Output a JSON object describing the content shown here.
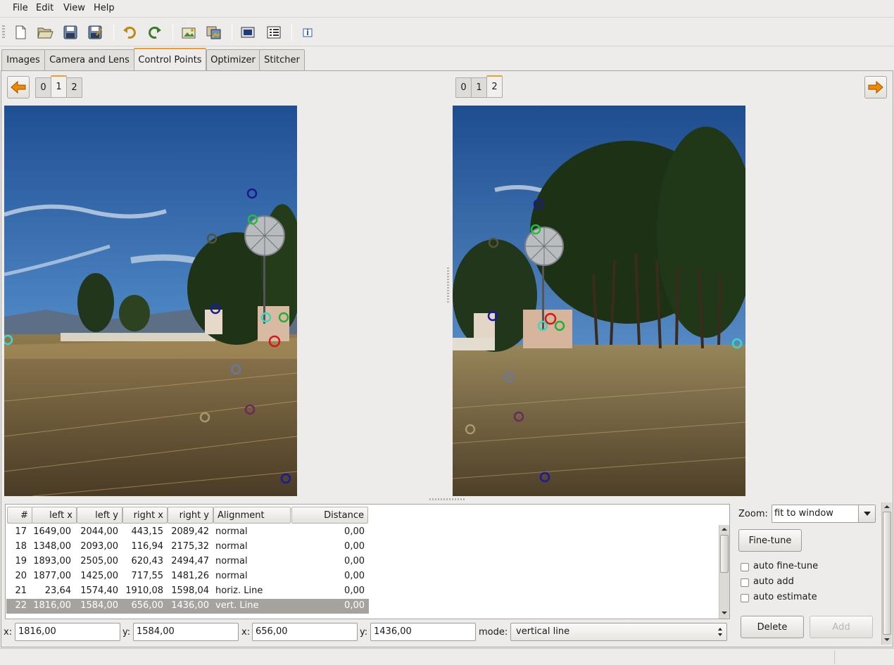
{
  "menu": [
    "File",
    "Edit",
    "View",
    "Help"
  ],
  "toolbar": {
    "buttons": [
      "new-icon",
      "open-icon",
      "save-icon",
      "save-as-icon",
      "undo-icon",
      "redo-icon",
      "add-image-icon",
      "add-series-icon",
      "preview-icon",
      "batch-icon",
      "info-icon"
    ]
  },
  "tabs": [
    "Images",
    "Camera and Lens",
    "Control Points",
    "Optimizer",
    "Stitcher"
  ],
  "active_tab": "Control Points",
  "left_panel": {
    "image_tabs": [
      "0",
      "1",
      "2"
    ],
    "active": "1"
  },
  "right_panel": {
    "image_tabs": [
      "0",
      "1",
      "2"
    ],
    "active": "2"
  },
  "colors": {
    "tab_accent": "#e8a135",
    "arrow": "#f08a00",
    "selection": "#a6a39f"
  },
  "table": {
    "headers": [
      "#",
      "left x",
      "left y",
      "right x",
      "right y",
      "Alignment",
      "Distance"
    ],
    "rows": [
      [
        "17",
        "1649,00",
        "2044,00",
        "443,15",
        "2089,42",
        "normal",
        "0,00"
      ],
      [
        "18",
        "1348,00",
        "2093,00",
        "116,94",
        "2175,32",
        "normal",
        "0,00"
      ],
      [
        "19",
        "1893,00",
        "2505,00",
        "620,43",
        "2494,47",
        "normal",
        "0,00"
      ],
      [
        "20",
        "1877,00",
        "1425,00",
        "717,55",
        "1481,26",
        "normal",
        "0,00"
      ],
      [
        "21",
        "23,64",
        "1574,40",
        "1910,08",
        "1598,04",
        "horiz. Line",
        "0,00"
      ],
      [
        "22",
        "1816,00",
        "1584,00",
        "656,00",
        "1436,00",
        "vert. Line",
        "0,00"
      ]
    ],
    "selected_row": "22"
  },
  "edit": {
    "x1_label": "x:",
    "x1": "1816,00",
    "y1_label": "y:",
    "y1": "1584,00",
    "x2_label": "x:",
    "x2": "656,00",
    "y2_label": "y:",
    "y2": "1436,00",
    "mode_label": "mode:",
    "mode": "vertical line"
  },
  "side": {
    "zoom_label": "Zoom:",
    "zoom": "fit to window",
    "fine_tune": "Fine-tune",
    "auto_fine_tune": "auto fine-tune",
    "auto_add": "auto add",
    "auto_estimate": "auto estimate",
    "delete": "Delete",
    "add": "Add"
  }
}
